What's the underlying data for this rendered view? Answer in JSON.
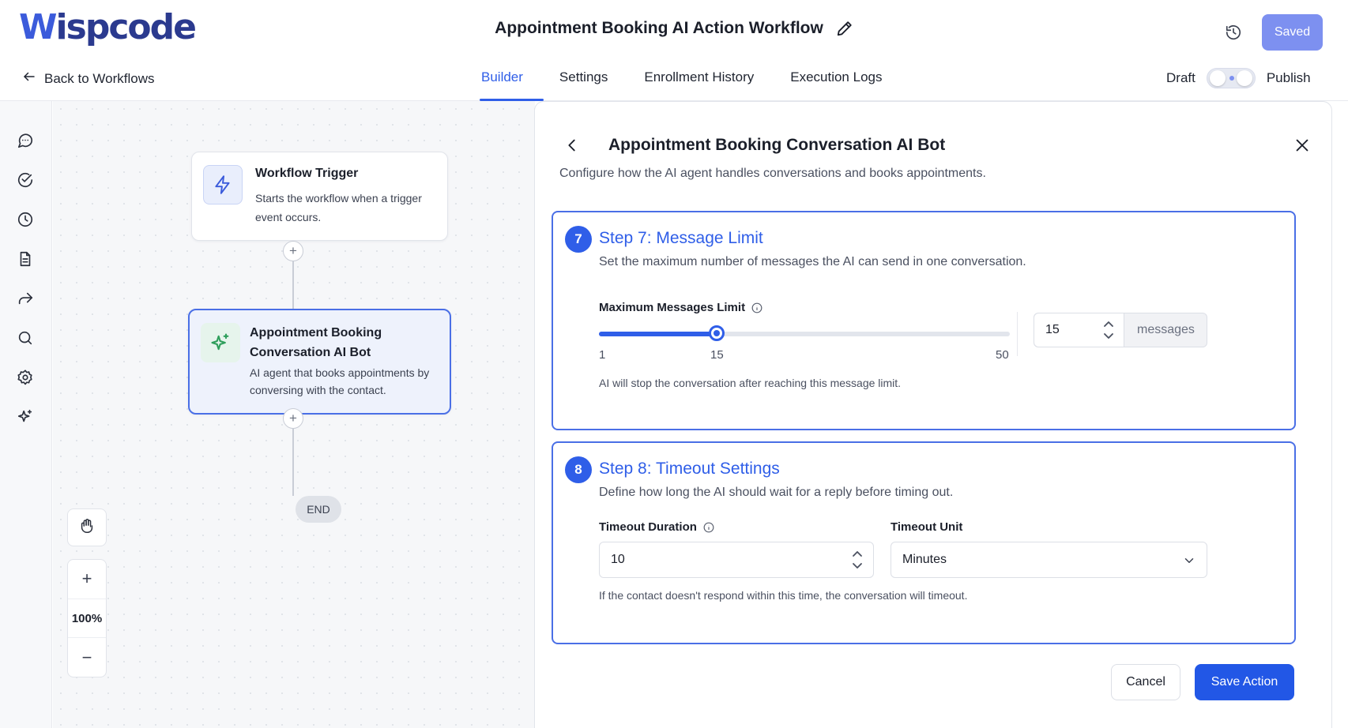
{
  "app": {
    "logo_w": "W",
    "logo_rest": "ispcode",
    "workflow_title": "Appointment Booking AI Action Workflow",
    "saved_label": "Saved",
    "back_label": "Back to Workflows",
    "tabs": [
      {
        "label": "Builder",
        "active": true
      },
      {
        "label": "Settings",
        "active": false
      },
      {
        "label": "Enrollment History",
        "active": false
      },
      {
        "label": "Execution Logs",
        "active": false
      }
    ],
    "draft_label": "Draft",
    "publish_label": "Publish"
  },
  "sidebar": {
    "icons": [
      "chat-icon",
      "check-circle-icon",
      "clock-icon",
      "document-icon",
      "share-icon",
      "search-icon",
      "gear-icon",
      "sparkle-icon"
    ]
  },
  "canvas": {
    "trigger_node": {
      "title": "Workflow Trigger",
      "description": "Starts the workflow when a trigger event occurs."
    },
    "ai_node": {
      "title": "Appointment Booking Conversation AI Bot",
      "description": "AI agent that books appointments by conversing with the contact."
    },
    "add_symbol": "+",
    "end_label": "END",
    "zoom_in": "+",
    "zoom_level": "100%",
    "zoom_out": "−"
  },
  "panel": {
    "title": "Appointment Booking Conversation AI Bot",
    "subtitle": "Configure how the AI agent handles conversations and books appointments.",
    "step7": {
      "number": "7",
      "title": "Step 7: Message Limit",
      "description": "Set the maximum number of messages the AI can send in one conversation.",
      "field_label": "Maximum Messages Limit",
      "slider_min": "1",
      "slider_value": "15",
      "slider_max": "50",
      "slider_min_value": 1,
      "slider_max_value": 50,
      "slider_current_value": 15,
      "input_value": "15",
      "unit_suffix": "messages",
      "helper": "AI will stop the conversation after reaching this message limit."
    },
    "step8": {
      "number": "8",
      "title": "Step 8: Timeout Settings",
      "description": "Define how long the AI should wait for a reply before timing out.",
      "duration_label": "Timeout Duration",
      "duration_value": "10",
      "unit_label": "Timeout Unit",
      "unit_value": "Minutes",
      "helper": "If the contact doesn't respond within this time, the conversation will timeout."
    },
    "cancel_label": "Cancel",
    "save_label": "Save Action"
  },
  "colors": {
    "accent": "#2f5ee8",
    "saved_button": "#7d90f0",
    "node_border": "#4a6fe6"
  }
}
